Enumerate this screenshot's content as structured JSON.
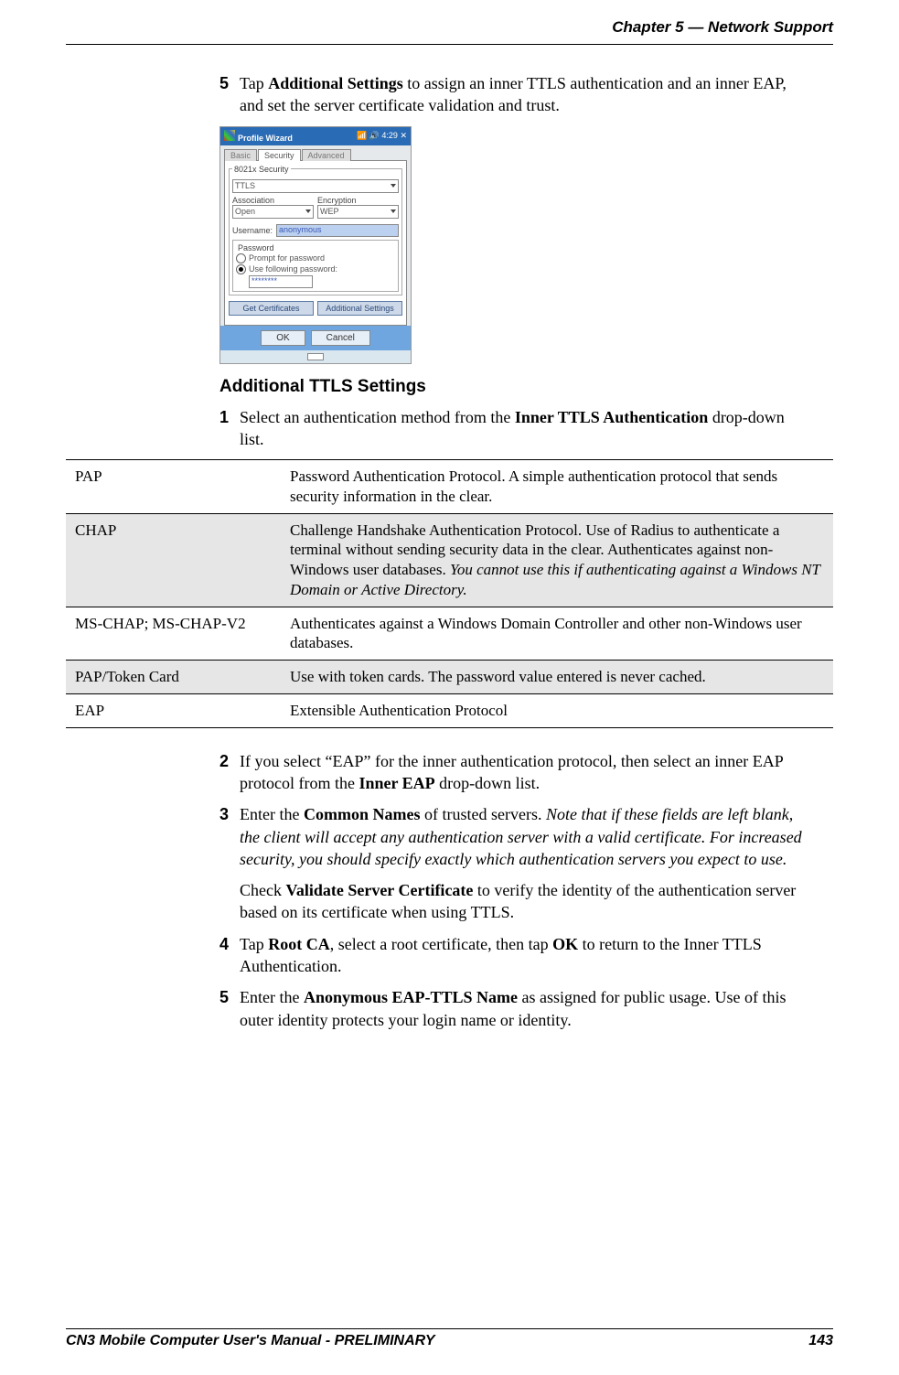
{
  "header": {
    "chapter": "Chapter 5 —  Network Support"
  },
  "intro_step": {
    "num": "5",
    "pre": "Tap ",
    "bold1": "Additional Settings",
    "post": " to assign an inner TTLS authentication and an inner EAP, and set the server certificate validation and trust."
  },
  "screenshot": {
    "title": "Profile Wizard",
    "time": "4:29",
    "tabs": {
      "basic": "Basic",
      "security": "Security",
      "advanced": "Advanced"
    },
    "legend": "8021x Security",
    "sel_ttls": "TTLS",
    "lbl_assoc": "Association",
    "val_assoc": "Open",
    "lbl_enc": "Encryption",
    "val_enc": "WEP",
    "lbl_user": "Username:",
    "val_user": "anonymous",
    "fs_pwd": "Password",
    "radio1": "Prompt for password",
    "radio2": "Use following password:",
    "pwd_dots": "********",
    "btn_getcert": "Get Certificates",
    "btn_addset": "Additional Settings",
    "btn_ok": "OK",
    "btn_cancel": "Cancel"
  },
  "section_heading": "Additional TTLS Settings",
  "step1": {
    "num": "1",
    "pre": "Select an authentication method from the ",
    "bold": "Inner TTLS Authentication",
    "post": " drop-down list."
  },
  "table": {
    "rows": [
      {
        "name": "PAP",
        "desc": "Password Authentication Protocol. A simple authentication protocol that sends security information in the clear."
      },
      {
        "name": "CHAP",
        "desc_pre": "Challenge Handshake Authentication Protocol. Use of Radius to authenticate a terminal without sending security data in the clear. Authenticates against non-Windows user databases. ",
        "desc_ital": "You cannot use this if authenticating against a Windows NT Domain or Active Directory."
      },
      {
        "name": "MS-CHAP; MS-CHAP-V2",
        "desc": "Authenticates against a Windows Domain Controller and other non-Windows user databases."
      },
      {
        "name": "PAP/Token Card",
        "desc": "Use with token cards. The password value entered is never cached."
      },
      {
        "name": "EAP",
        "desc": "Extensible Authentication Protocol"
      }
    ]
  },
  "step2": {
    "num": "2",
    "pre": "If you select “EAP” for the inner authentication protocol, then select an inner EAP protocol from the ",
    "bold": "Inner EAP",
    "post": " drop-down list."
  },
  "step3": {
    "num": "3",
    "pre": "Enter the ",
    "bold": "Common Names",
    "mid": " of trusted servers. ",
    "ital": "Note that if these fields are left blank, the client will accept any authentication server with a valid certificate. For increased security, you should specify exactly which authentication servers you expect to use."
  },
  "step3b": {
    "pre": "Check ",
    "bold": "Validate Server Certificate",
    "post": " to verify the identity of the authentication server based on its certificate when using TTLS."
  },
  "step4": {
    "num": "4",
    "pre": "Tap ",
    "bold1": "Root CA",
    "mid": ", select a root certificate, then tap ",
    "bold2": "OK",
    "post": " to return to the Inner TTLS Authentication."
  },
  "step5": {
    "num": "5",
    "pre": "Enter the ",
    "bold": "Anonymous EAP-TTLS Name",
    "post": " as assigned for public usage. Use of this outer identity protects your login name or identity."
  },
  "footer": {
    "left": "CN3 Mobile Computer User's Manual - PRELIMINARY",
    "right": "143"
  }
}
